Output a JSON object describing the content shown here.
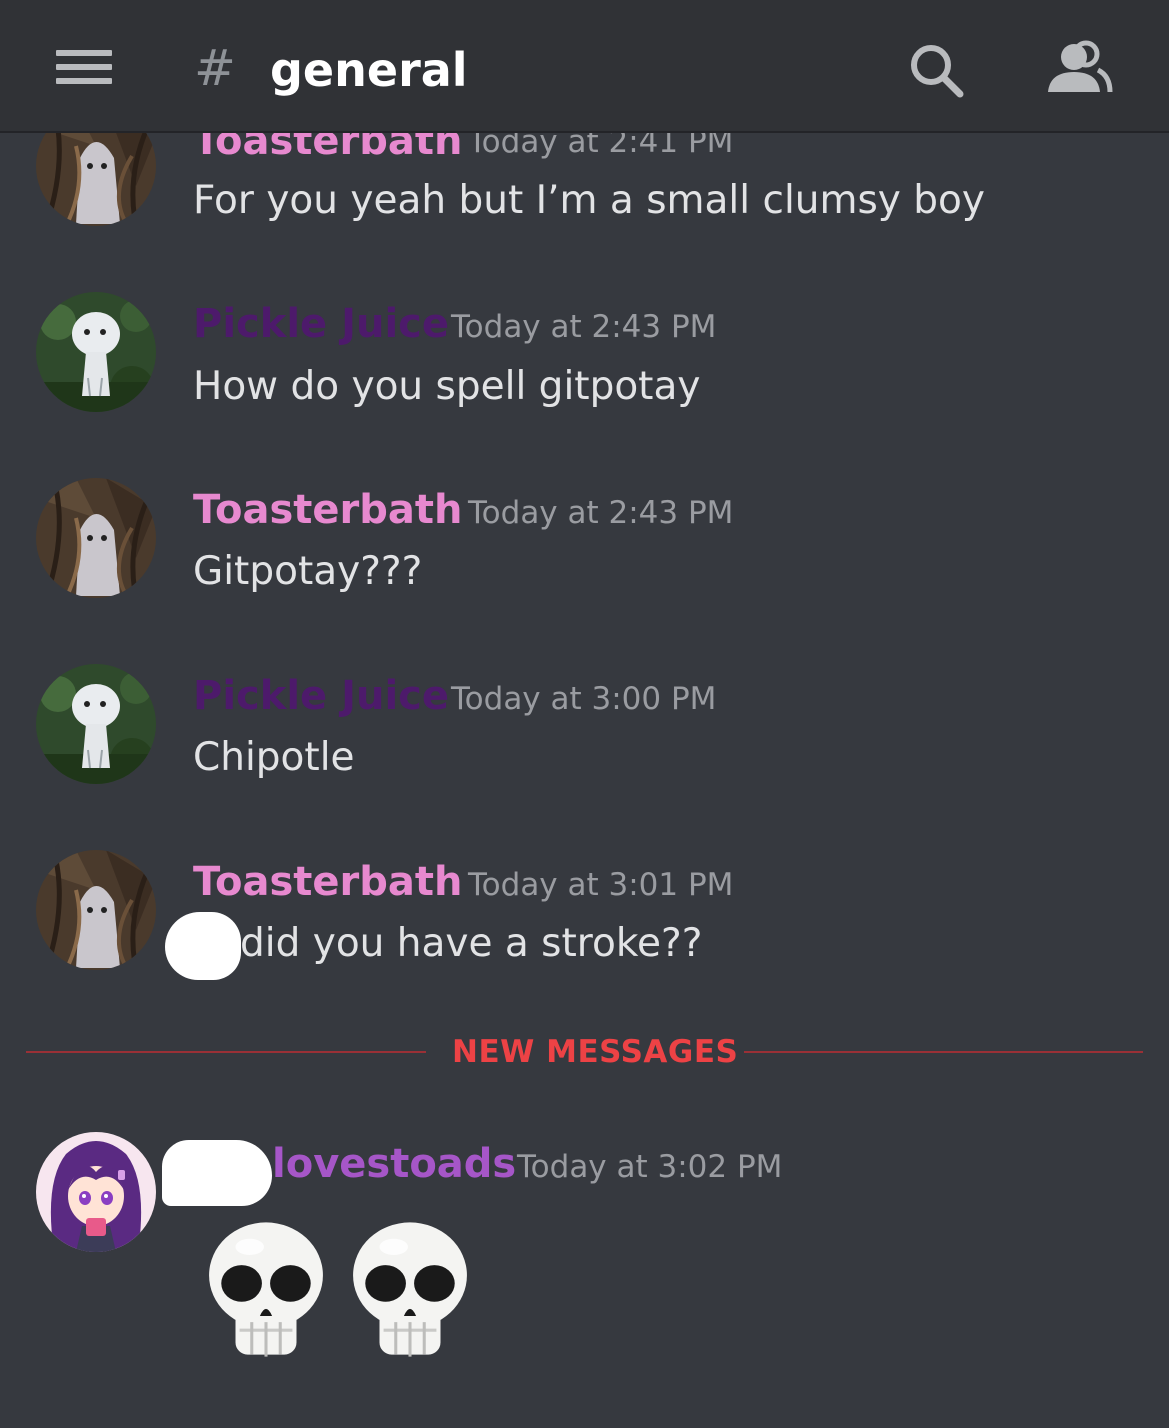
{
  "header": {
    "hash_symbol": "#",
    "channel_name": "general"
  },
  "messages": [
    {
      "author": "Toasterbath",
      "timestamp": "Today at 2:41 PM",
      "content": "For you yeah but I’m a small clumsy boy"
    },
    {
      "author": "Pickle Juice",
      "timestamp": "Today at 2:43 PM",
      "content": "How do you spell gitpotay"
    },
    {
      "author": "Toasterbath",
      "timestamp": "Today at 2:43 PM",
      "content": "Gitpotay???"
    },
    {
      "author": "Pickle Juice",
      "timestamp": "Today at 3:00 PM",
      "content": "Chipotle"
    },
    {
      "author": "Toasterbath",
      "timestamp": "Today at 3:01 PM",
      "content": "did you have a stroke??"
    },
    {
      "author": "lovestoads",
      "timestamp": "Today at 3:02 PM",
      "content": "skull emoji x2"
    }
  ],
  "new_messages_label": "NEW MESSAGES",
  "colors": {
    "background": "#36393f",
    "header": "#303236",
    "toasterbath": "#e789cf",
    "pickle_juice": "#4d1a6b",
    "lovestoads": "#a656c8",
    "new_messages": "#ed4245"
  },
  "icons": {
    "menu": "hamburger-menu-icon",
    "search": "search-icon",
    "members": "members-icon",
    "emoji": "skull-emoji"
  }
}
